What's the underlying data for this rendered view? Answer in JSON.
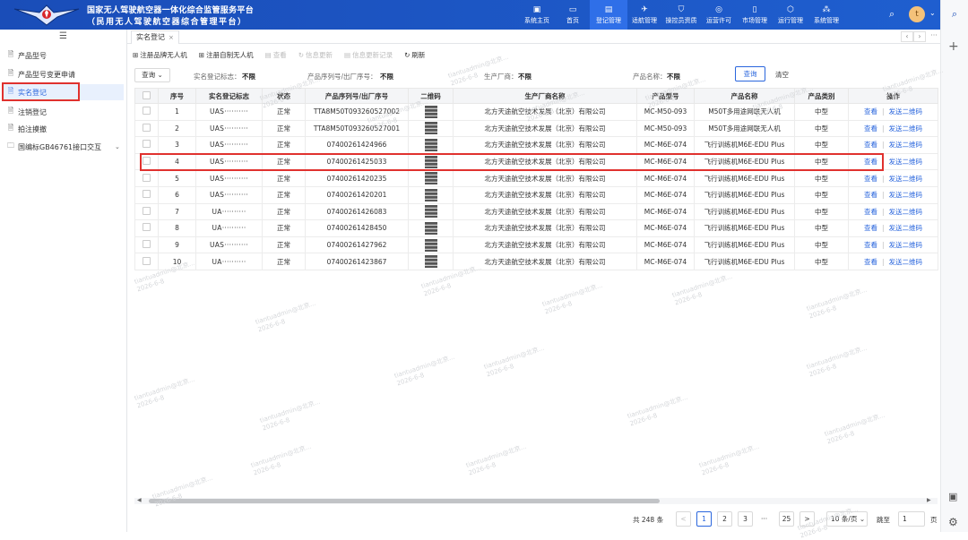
{
  "header": {
    "title_line1": "国家无人驾驶航空器一体化综合监管服务平台",
    "title_line2": "（民用无人驾驶航空器综合管理平台）",
    "nav": [
      {
        "label": "系统主页",
        "icon": "monitor-icon"
      },
      {
        "label": "首页",
        "icon": "desktop-icon"
      },
      {
        "label": "登记管理",
        "icon": "register-icon"
      },
      {
        "label": "适航管理",
        "icon": "plane-icon"
      },
      {
        "label": "操控员资质",
        "icon": "shield-icon"
      },
      {
        "label": "运营许可",
        "icon": "compass-icon"
      },
      {
        "label": "市场管理",
        "icon": "document-icon"
      },
      {
        "label": "运行管理",
        "icon": "hexagon-icon"
      },
      {
        "label": "系统管理",
        "icon": "cluster-icon"
      }
    ],
    "active_nav": "登记管理",
    "avatar_text": "t"
  },
  "sidebar": {
    "items": [
      {
        "label": "产品型号"
      },
      {
        "label": "产品型号变更申请"
      },
      {
        "label": "实名登记"
      },
      {
        "label": "注销登记"
      },
      {
        "label": "拍注摸撤"
      },
      {
        "label": "国编标GB46761接口交互"
      }
    ],
    "active": "实名登记"
  },
  "tabs": [
    {
      "label": "实名登记",
      "close": "×"
    }
  ],
  "toolbar": {
    "register_brand": "注册品牌无人机",
    "register_custom": "注册自制无人机",
    "view": "查看",
    "info_update": "信息更新",
    "info_update_record": "信息更新记录",
    "refresh": "刷新"
  },
  "filters": {
    "query_button": "查询",
    "realname_label": "实名登记标志：",
    "realname_value": "不限",
    "serial_label": "产品序列号/出厂序号：",
    "serial_value": "不限",
    "manufacturer_label": "生产厂商：",
    "manufacturer_value": "不限",
    "product_name_label": "产品名称：",
    "product_name_value": "不限",
    "search_button": "查询",
    "clear_button": "清空"
  },
  "table": {
    "headers": [
      "",
      "序号",
      "实名登记标志",
      "状态",
      "产品序列号/出厂序号",
      "二维码",
      "生产厂商名称",
      "产品型号",
      "产品名称",
      "产品类别",
      "操作"
    ],
    "rows": [
      {
        "no": "1",
        "mark": "UAS··········",
        "status": "正常",
        "serial": "TTA8M50T093260527002",
        "maker": "北方天途航空技术发展（北京）有限公司",
        "model": "MC-M50-093",
        "name": "M50T多用途网联无人机",
        "category": "中型",
        "view": "查看",
        "send": "发送二维码"
      },
      {
        "no": "2",
        "mark": "UAS··········",
        "status": "正常",
        "serial": "TTA8M50T093260527001",
        "maker": "北方天途航空技术发展（北京）有限公司",
        "model": "MC-M50-093",
        "name": "M50T多用途网联无人机",
        "category": "中型",
        "view": "查看",
        "send": "发送二维码"
      },
      {
        "no": "3",
        "mark": "UAS··········",
        "status": "正常",
        "serial": "07400261424966",
        "maker": "北方天途航空技术发展（北京）有限公司",
        "model": "MC-M6E-074",
        "name": "飞行训练机M6E-EDU Plus",
        "category": "中型",
        "view": "查看",
        "send": "发送二维码"
      },
      {
        "no": "4",
        "mark": "UAS··········",
        "status": "正常",
        "serial": "07400261425033",
        "maker": "北方天途航空技术发展（北京）有限公司",
        "model": "MC-M6E-074",
        "name": "飞行训练机M6E-EDU Plus",
        "category": "中型",
        "view": "查看",
        "send": "发送二维码"
      },
      {
        "no": "5",
        "mark": "UAS··········",
        "status": "正常",
        "serial": "07400261420235",
        "maker": "北方天途航空技术发展（北京）有限公司",
        "model": "MC-M6E-074",
        "name": "飞行训练机M6E-EDU Plus",
        "category": "中型",
        "view": "查看",
        "send": "发送二维码"
      },
      {
        "no": "6",
        "mark": "UAS··········",
        "status": "正常",
        "serial": "07400261420201",
        "maker": "北方天途航空技术发展（北京）有限公司",
        "model": "MC-M6E-074",
        "name": "飞行训练机M6E-EDU Plus",
        "category": "中型",
        "view": "查看",
        "send": "发送二维码"
      },
      {
        "no": "7",
        "mark": "UA··········",
        "status": "正常",
        "serial": "07400261426083",
        "maker": "北方天途航空技术发展（北京）有限公司",
        "model": "MC-M6E-074",
        "name": "飞行训练机M6E-EDU Plus",
        "category": "中型",
        "view": "查看",
        "send": "发送二维码"
      },
      {
        "no": "8",
        "mark": "UA··········",
        "status": "正常",
        "serial": "07400261428450",
        "maker": "北方天途航空技术发展（北京）有限公司",
        "model": "MC-M6E-074",
        "name": "飞行训练机M6E-EDU Plus",
        "category": "中型",
        "view": "查看",
        "send": "发送二维码"
      },
      {
        "no": "9",
        "mark": "UAS··········",
        "status": "正常",
        "serial": "07400261427962",
        "maker": "北方天途航空技术发展（北京）有限公司",
        "model": "MC-M6E-074",
        "name": "飞行训练机M6E-EDU Plus",
        "category": "中型",
        "view": "查看",
        "send": "发送二维码"
      },
      {
        "no": "10",
        "mark": "UA··········",
        "status": "正常",
        "serial": "07400261423867",
        "maker": "北方天途航空技术发展（北京）有限公司",
        "model": "MC-M6E-074",
        "name": "飞行训练机M6E-EDU Plus",
        "category": "中型",
        "view": "查看",
        "send": "发送二维码"
      }
    ],
    "highlighted_row": "4"
  },
  "pagination": {
    "total": "共 248 条",
    "prev": "<",
    "pages": [
      "1",
      "2",
      "3"
    ],
    "ellipsis": "···",
    "last": "25",
    "next": ">",
    "page_size": "10 条/页",
    "jump_label": "跳至",
    "jump_value": "1",
    "page_unit": "页"
  },
  "watermark": {
    "user": "tiantuadmin@北京...",
    "date": "2026-6-8"
  },
  "colors": {
    "header": "#1f5fd0",
    "active_nav": "#2f6fe8",
    "accent": "#2a66dd",
    "highlight": "#e0312e"
  }
}
